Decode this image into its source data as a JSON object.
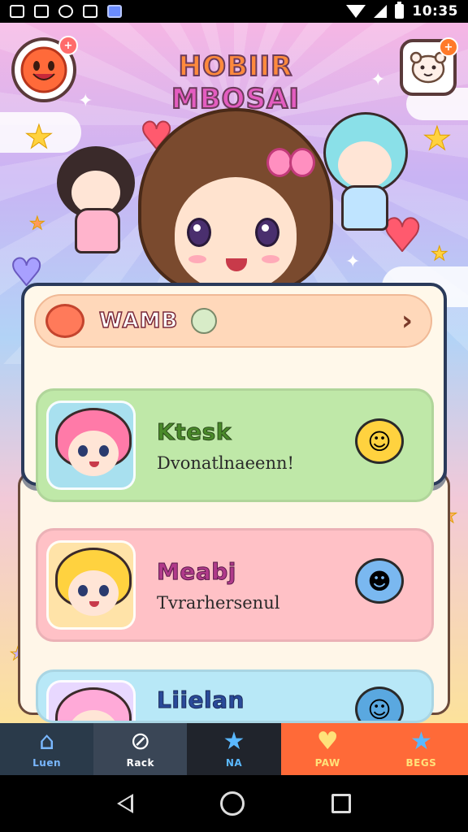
{
  "status_bar": {
    "time": "10:35",
    "notification_icons": [
      "photo-icon",
      "image-icon",
      "sync-icon",
      "image-icon",
      "gallery-icon"
    ]
  },
  "app": {
    "title_part1": "HOBIIR",
    "title_part2": "MBOSAI",
    "home_badge": "+",
    "settings_badge": "+"
  },
  "header_row": {
    "label": "WAMB"
  },
  "cards": [
    {
      "name": "Ktesk",
      "subtitle": "Dvonatlnaeenn!",
      "name_color": "#4a8a2a",
      "bg": "#bfe8a8",
      "avatar_hair": "#ff7aa8",
      "avatar_bg": "#a8e0ef",
      "emoji_bg": "#ffd23f",
      "emoji": "☺"
    },
    {
      "name": "Meabj",
      "subtitle": "Tvrarhersenul",
      "name_color": "#b03a8a",
      "bg": "#ffc1c6",
      "avatar_hair": "#ffd23f",
      "avatar_bg": "#ffe3a8",
      "emoji_bg": "#7ab8f0",
      "emoji": "☻"
    },
    {
      "name": "Liielan",
      "subtitle": "",
      "name_color": "#2a4a9a",
      "bg": "#b8e8f7",
      "avatar_hair": "#ffaad8",
      "avatar_bg": "#e8d8ff",
      "emoji_bg": "#5aa8e0",
      "emoji": "☺"
    }
  ],
  "bottom_nav": [
    {
      "label": "Luen",
      "icon": "house-icon",
      "bg": "#2a3a4a",
      "color": "#7ab8ff"
    },
    {
      "label": "Rack",
      "icon": "compass-icon",
      "bg": "#3a4656",
      "color": "#ffffff"
    },
    {
      "label": "NA",
      "icon": "star-icon",
      "bg": "#20242c",
      "color": "#5ab8ff"
    },
    {
      "label": "PAW",
      "icon": "heart-icon",
      "bg": "#ff6a38",
      "color": "#ffe27a"
    },
    {
      "label": "BEGS",
      "icon": "star-icon",
      "bg": "#ff6a38",
      "color": "#ffe27a"
    }
  ]
}
